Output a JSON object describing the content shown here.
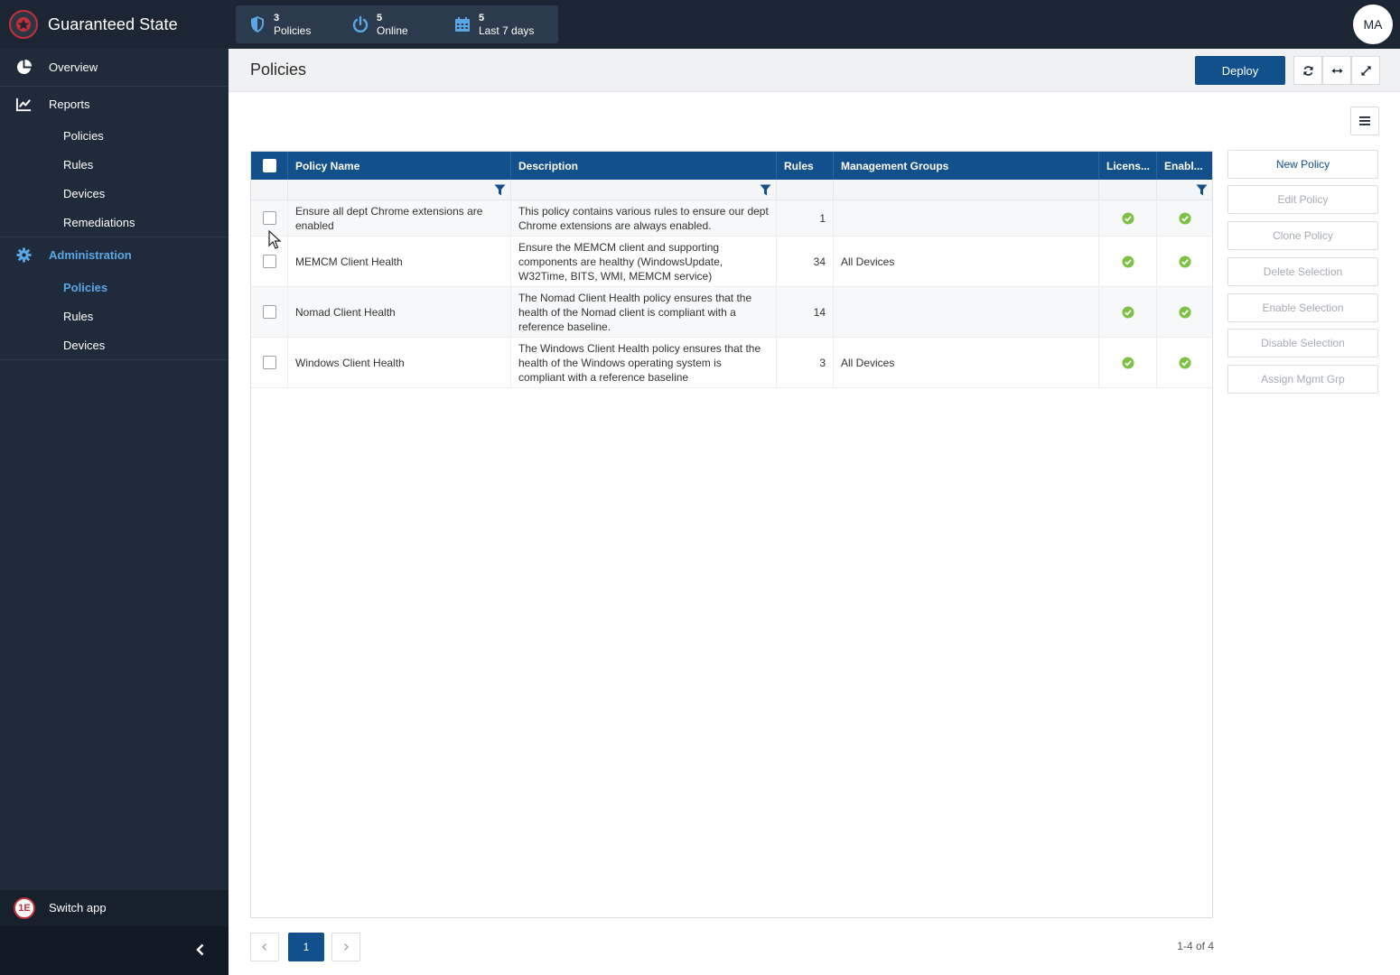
{
  "app": {
    "title": "Guaranteed State"
  },
  "stats": [
    {
      "icon": "shield-icon",
      "value": "3",
      "label": "Policies"
    },
    {
      "icon": "power-icon",
      "value": "5",
      "label": "Online"
    },
    {
      "icon": "calendar-icon",
      "value": "5",
      "label": "Last 7 days"
    }
  ],
  "user": {
    "initials": "MA"
  },
  "sidebar": {
    "overview": "Overview",
    "reports": {
      "label": "Reports",
      "items": [
        "Policies",
        "Rules",
        "Devices",
        "Remediations"
      ]
    },
    "administration": {
      "label": "Administration",
      "items": [
        "Policies",
        "Rules",
        "Devices"
      ],
      "active_item": "Policies"
    },
    "switch_app": "Switch app"
  },
  "page": {
    "title": "Policies",
    "deploy": "Deploy"
  },
  "table": {
    "columns": [
      "Policy Name",
      "Description",
      "Rules",
      "Management Groups",
      "Licens...",
      "Enabl..."
    ],
    "rows": [
      {
        "name": "Ensure all dept Chrome extensions are enabled",
        "description": "This policy contains various rules to ensure our dept Chrome extensions are always enabled.",
        "rules": "1",
        "groups": "",
        "licensed": true,
        "enabled": true
      },
      {
        "name": "MEMCM Client Health",
        "description": "Ensure the MEMCM client and supporting components are healthy (WindowsUpdate, W32Time, BITS, WMI, MEMCM service)",
        "rules": "34",
        "groups": "All Devices",
        "licensed": true,
        "enabled": true
      },
      {
        "name": "Nomad Client Health",
        "description": "The Nomad Client Health policy ensures that the health of the Nomad client is compliant with a reference baseline.",
        "rules": "14",
        "groups": "",
        "licensed": true,
        "enabled": true
      },
      {
        "name": "Windows Client Health",
        "description": "The Windows Client Health policy ensures that the health of the Windows operating system is compliant with a reference baseline",
        "rules": "3",
        "groups": "All Devices",
        "licensed": true,
        "enabled": true
      }
    ]
  },
  "actions": {
    "new_policy": "New Policy",
    "edit_policy": "Edit Policy",
    "clone_policy": "Clone Policy",
    "delete_selection": "Delete Selection",
    "enable_selection": "Enable Selection",
    "disable_selection": "Disable Selection",
    "assign_mgmt_grp": "Assign Mgmt Grp"
  },
  "pagination": {
    "current": "1",
    "info": "1-4 of 4"
  },
  "colors": {
    "topbar": "#1b2533",
    "sidebar": "#1f2b3a",
    "accent": "#11508a",
    "active_nav": "#5aa7e6",
    "ok": "#7cc242"
  }
}
